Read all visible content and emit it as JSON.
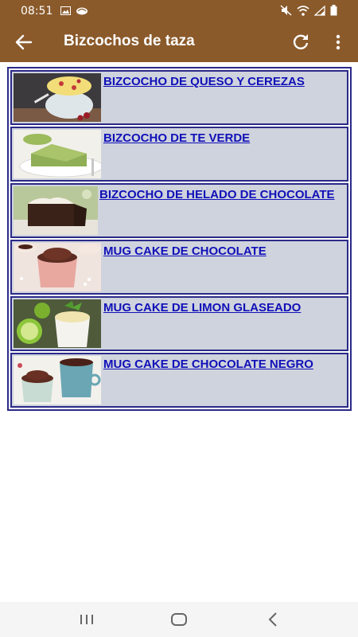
{
  "status_bar": {
    "time": "08:51",
    "icons": [
      "image-icon",
      "cloud-icon",
      "mute-icon",
      "wifi-icon",
      "signal-icon",
      "battery-icon"
    ]
  },
  "toolbar": {
    "title": "Bizcochos de taza",
    "back_icon": "arrow-back-icon",
    "refresh_icon": "refresh-icon",
    "more_icon": "more-vert-icon"
  },
  "recipes": [
    {
      "title": "BIZCOCHO DE QUESO Y CEREZAS"
    },
    {
      "title": "BIZCOCHO DE TE VERDE"
    },
    {
      "title": "BIZCOCHO DE HELADO DE CHOCOLATE"
    },
    {
      "title": "MUG CAKE DE CHOCOLATE"
    },
    {
      "title": "MUG CAKE DE LIMON GLASEADO"
    },
    {
      "title": "MUG CAKE DE CHOCOLATE NEGRO"
    }
  ],
  "colors": {
    "bar": "#8b5a2b",
    "row_bg": "#cfd3dd",
    "border": "#2a2a88",
    "link": "#1010b8"
  },
  "navigation": {
    "icons": [
      "recent-apps-icon",
      "home-icon",
      "back-nav-icon"
    ]
  }
}
